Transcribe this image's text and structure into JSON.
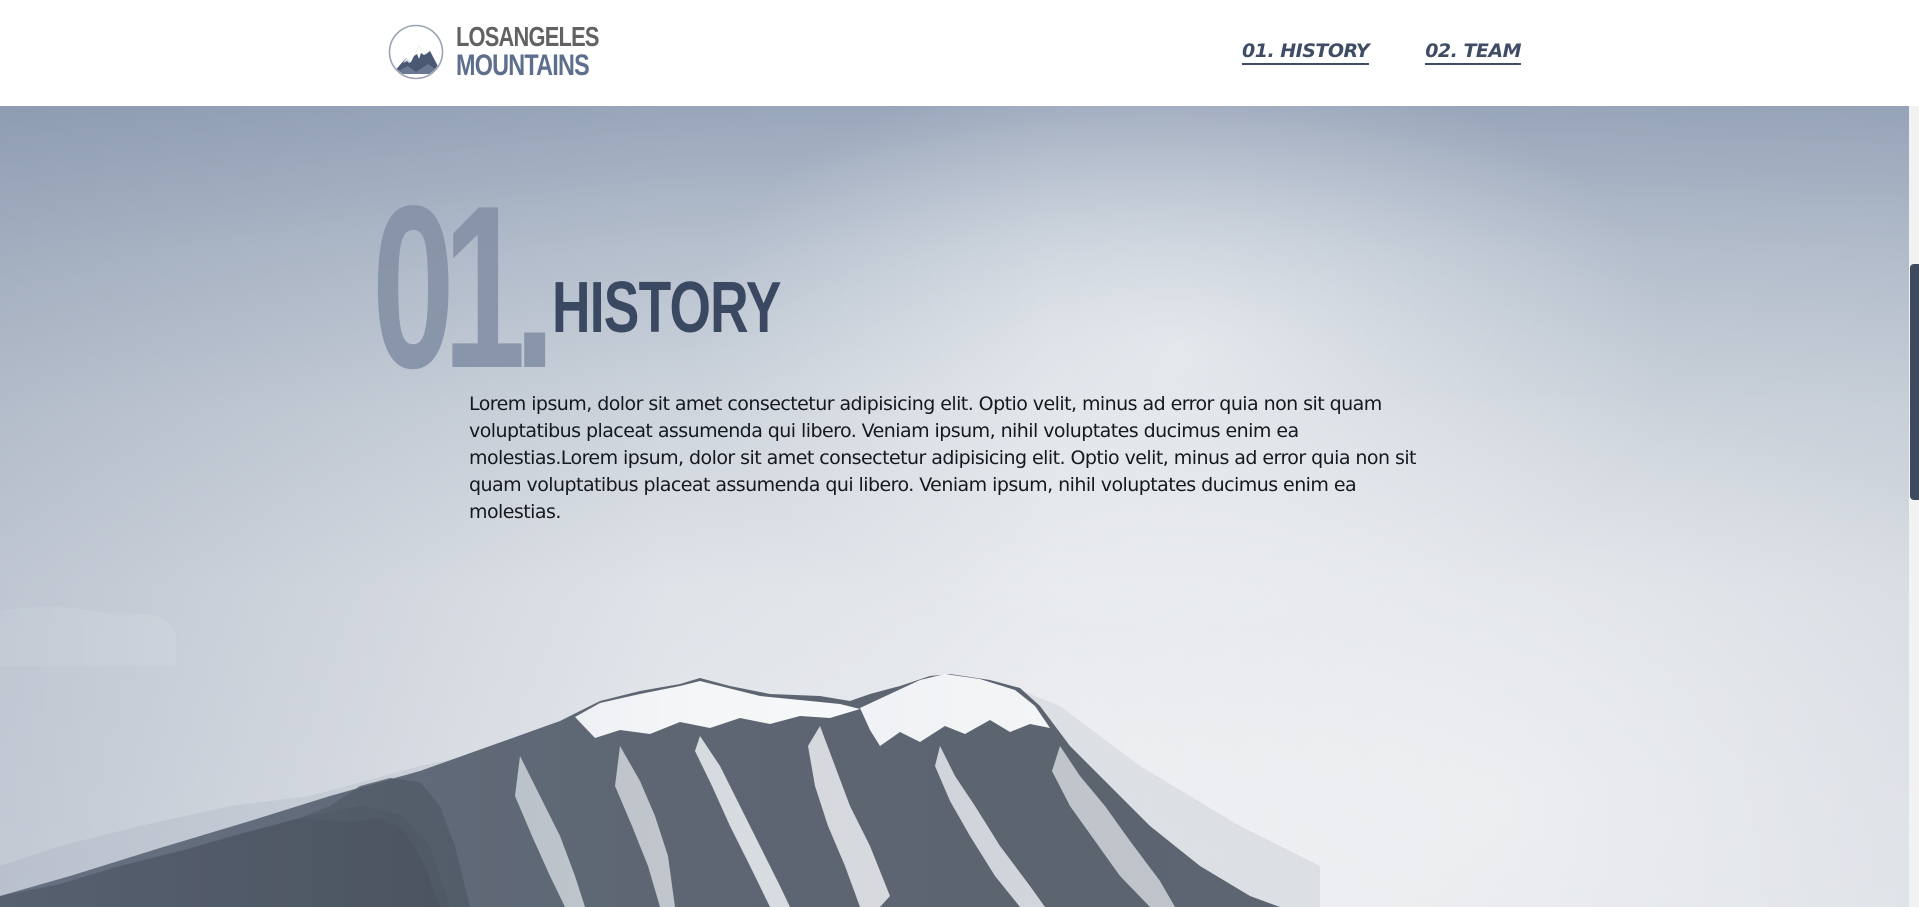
{
  "brand": {
    "line1": "LOSANGELES",
    "line2": "MOUNTAINS",
    "logo_icon": "mountain-logo-icon"
  },
  "nav": {
    "items": [
      {
        "label": "01. HISTORY"
      },
      {
        "label": "02. TEAM"
      }
    ]
  },
  "section": {
    "number": "01.",
    "title": "HISTORY",
    "body": "Lorem ipsum, dolor sit amet consectetur adipisicing elit. Optio velit, minus ad error quia non sit quam voluptatibus placeat assumenda qui libero. Veniam ipsum, nihil voluptates ducimus enim ea molestias.Lorem ipsum, dolor sit amet consectetur adipisicing elit. Optio velit, minus ad error quia non sit quam voluptatibus placeat assumenda qui libero. Veniam ipsum, nihil voluptates ducimus enim ea molestias."
  },
  "colors": {
    "nav_text": "#3f4c66",
    "big_number": "#8793a8",
    "title": "#3a4862",
    "scroll_thumb": "#3e4a5f"
  }
}
